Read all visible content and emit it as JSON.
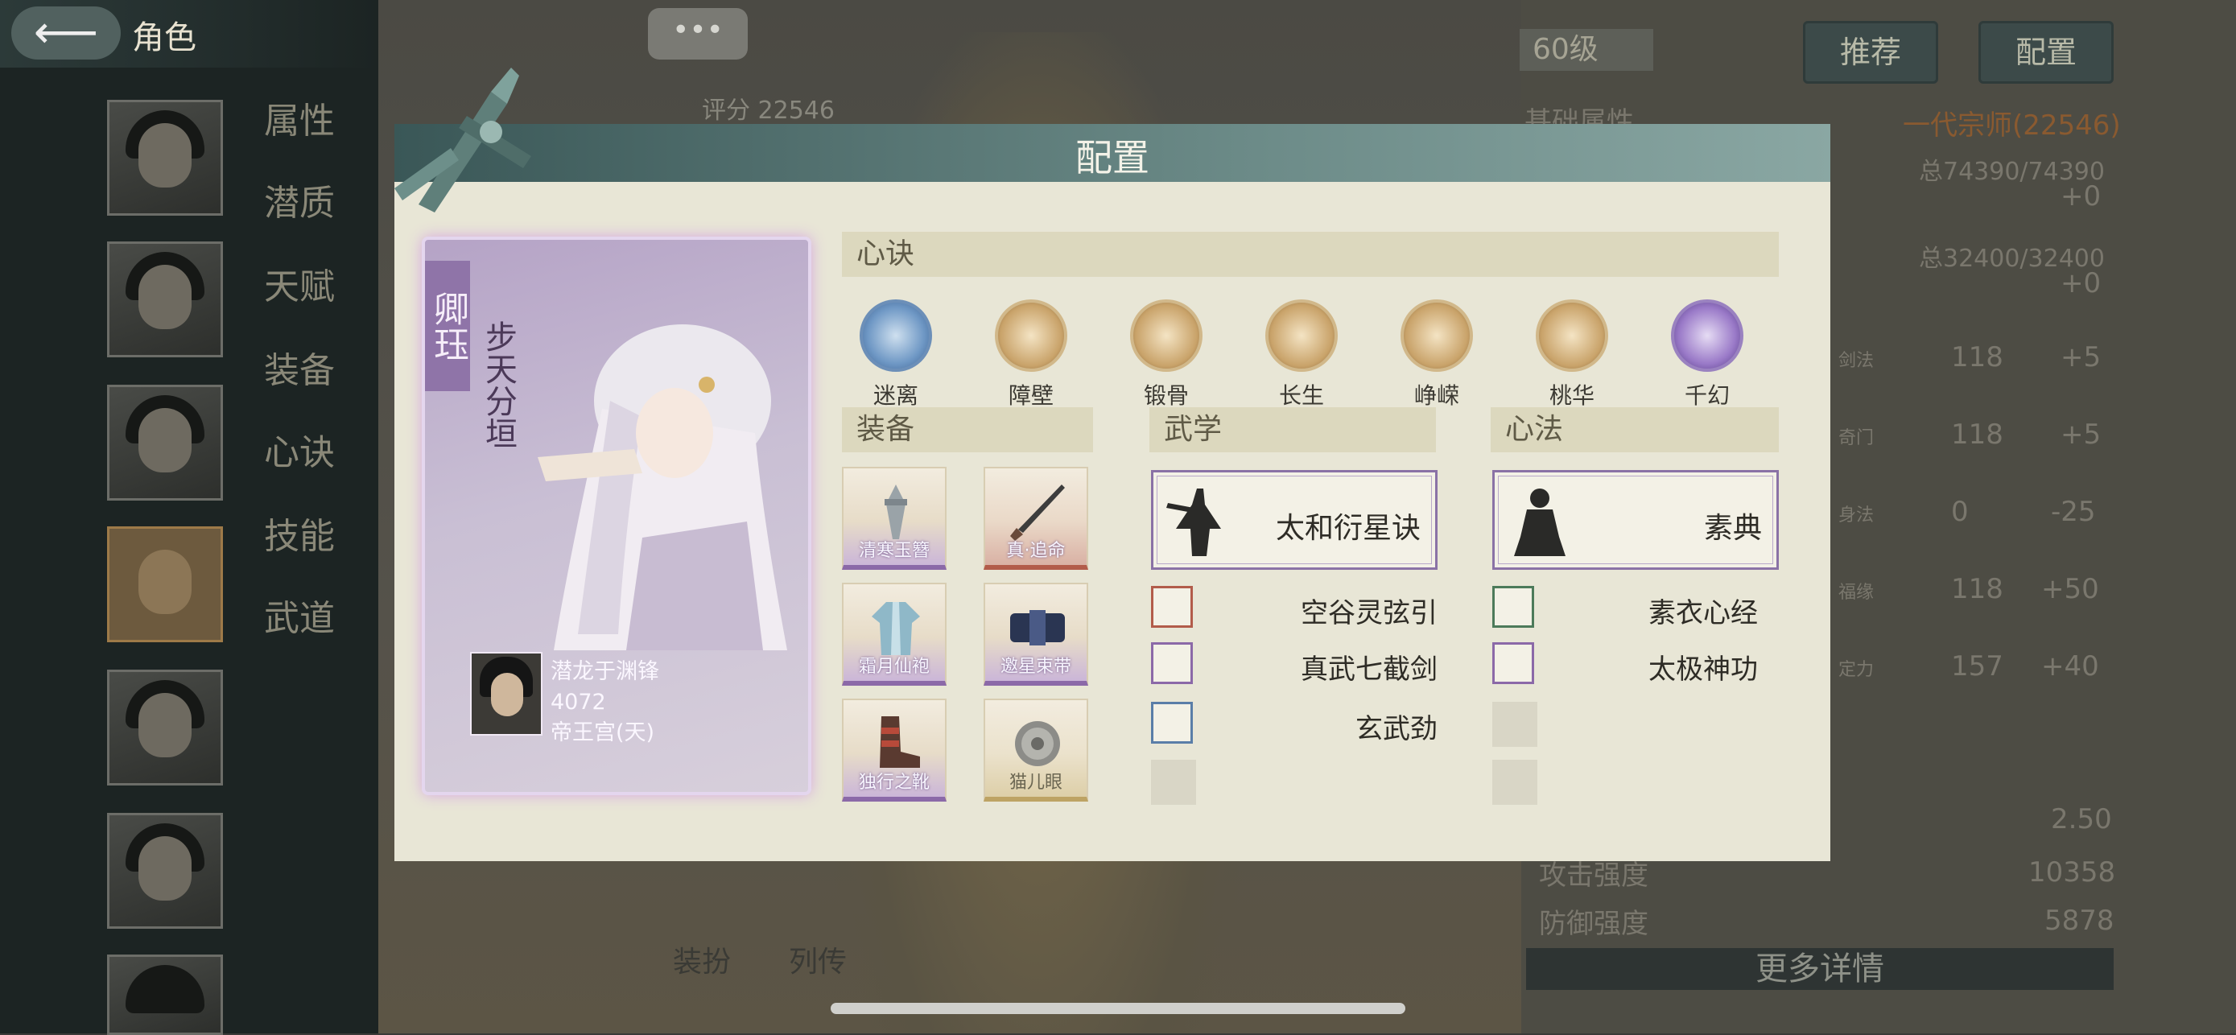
{
  "header": {
    "back_icon": "back-arrow-icon",
    "title": "角色"
  },
  "sidebar": {
    "menu": [
      "属性",
      "潜质",
      "天赋",
      "装备",
      "心诀",
      "技能",
      "武道"
    ]
  },
  "scene": {
    "chat_label": "•••",
    "score_label": "评分 22546",
    "bottom_tabs": [
      "装扮",
      "列传"
    ]
  },
  "right_panel": {
    "level": "60级",
    "recommend_btn": "推荐",
    "config_btn": "配置",
    "section_title": "基础属性",
    "rank": "一代宗师(22546)",
    "total1": "总74390/74390",
    "plus1": "+0",
    "total2": "总32400/32400",
    "plus2": "+0",
    "stats": [
      {
        "name": "剑法",
        "value": "118",
        "delta": "+5"
      },
      {
        "name": "奇门",
        "value": "118",
        "delta": "+5"
      },
      {
        "name": "身法",
        "value": "0",
        "delta": "-25"
      },
      {
        "name": "福缘",
        "value": "118",
        "delta": "+50"
      },
      {
        "name": "定力",
        "value": "157",
        "delta": "+40"
      }
    ],
    "val_250": "2.50",
    "attack_label": "攻击强度",
    "attack_value": "10358",
    "defense_label": "防御强度",
    "defense_value": "5878",
    "more_btn": "更多详情"
  },
  "modal": {
    "title": "配置",
    "card": {
      "name": "卿珏",
      "title": "步天分垣",
      "owner_name": "潜龙于渊锋",
      "owner_score": "4072",
      "owner_server": "帝王宫(天)"
    },
    "xinjue_header": "心诀",
    "xinjue": [
      {
        "label": "迷离",
        "icon": "mili-icon",
        "color": "#5a86b8"
      },
      {
        "label": "障壁",
        "icon": "zhangbi-icon",
        "color": "#c9a763"
      },
      {
        "label": "锻骨",
        "icon": "duangu-icon",
        "color": "#c9a763"
      },
      {
        "label": "长生",
        "icon": "changsheng-icon",
        "color": "#c9a763"
      },
      {
        "label": "峥嵘",
        "icon": "zhengrong-icon",
        "color": "#c9a763"
      },
      {
        "label": "桃华",
        "icon": "taohua-icon",
        "color": "#c9a763"
      },
      {
        "label": "千幻",
        "icon": "qianhuan-icon",
        "color": "#7a5aa8"
      }
    ],
    "equip_header": "装备",
    "equipment": [
      {
        "label": "清寒玉簪",
        "icon": "hairpin-icon",
        "tier": "purple"
      },
      {
        "label": "真·追命",
        "icon": "sword-icon",
        "tier": "red"
      },
      {
        "label": "霜月仙袍",
        "icon": "robe-icon",
        "tier": "purple"
      },
      {
        "label": "邀星束带",
        "icon": "belt-icon",
        "tier": "purple"
      },
      {
        "label": "独行之靴",
        "icon": "boots-icon",
        "tier": "purple"
      },
      {
        "label": "猫儿眼",
        "icon": "gem-icon",
        "tier": "gold"
      }
    ],
    "wuxue_header": "武学",
    "wuxue_main": "太和衍星诀",
    "wuxue_list": [
      {
        "name": "空谷灵弦引",
        "color": "#b25c4a"
      },
      {
        "name": "真武七截剑",
        "color": "#8b69a8"
      },
      {
        "name": "玄武劲",
        "color": "#5a7ea8"
      }
    ],
    "xinfa_header": "心法",
    "xinfa_main": "素典",
    "xinfa_list": [
      {
        "name": "素衣心经",
        "color": "#4c7a5a"
      },
      {
        "name": "太极神功",
        "color": "#8b69a8"
      }
    ]
  }
}
